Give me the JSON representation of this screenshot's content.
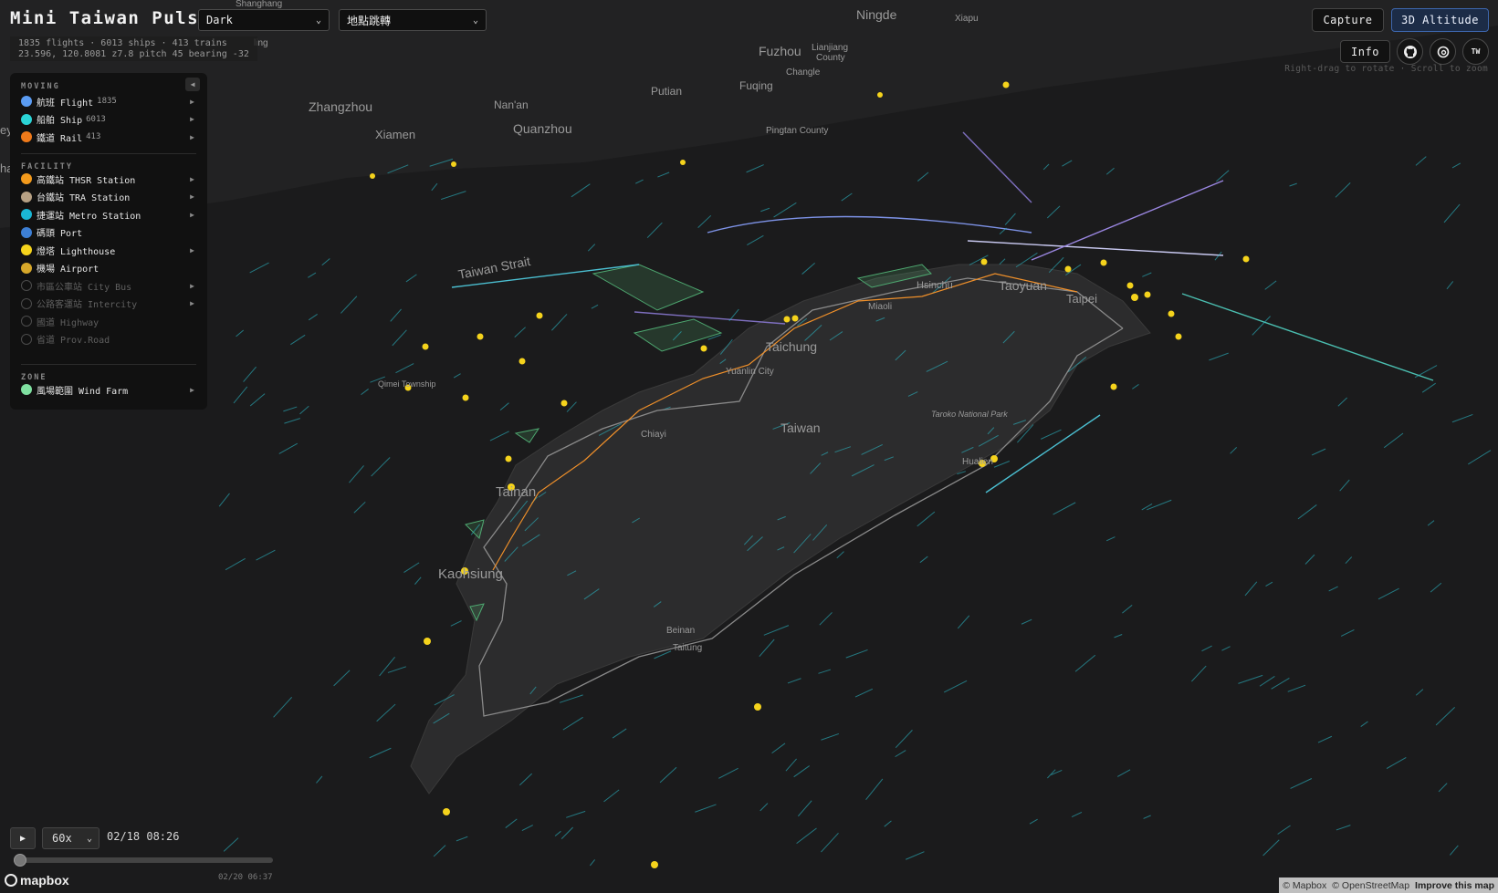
{
  "app": {
    "title": "Mini Taiwan Pulse",
    "theme_select": "Dark",
    "location_select": "地點跳轉"
  },
  "stats": {
    "line1": "1835 flights · 6013 ships · 413 trains",
    "line2": "23.596, 120.8081 z7.8 pitch 45 bearing -32"
  },
  "legend": {
    "collapse_icon": "◀",
    "moving_title": "MOVING",
    "moving": [
      {
        "label": "航班 Flight",
        "count": "1835",
        "color": "#5b9cf2"
      },
      {
        "label": "船舶 Ship",
        "count": "6013",
        "color": "#2bd4d6"
      },
      {
        "label": "鐵道 Rail",
        "count": "413",
        "color": "#f07a1a"
      }
    ],
    "facility_title": "FACILITY",
    "facilities": [
      {
        "label": "高鐵站 THSR Station",
        "color": "#f39a1c",
        "enabled": true,
        "arrow": true
      },
      {
        "label": "台鐵站 TRA Station",
        "color": "#b7a184",
        "enabled": true,
        "arrow": true
      },
      {
        "label": "捷運站 Metro Station",
        "color": "#1ab6d4",
        "enabled": true,
        "arrow": true
      },
      {
        "label": "碼頭 Port",
        "color": "#3d7fd4",
        "enabled": true,
        "arrow": false
      },
      {
        "label": "燈塔 Lighthouse",
        "color": "#f5d31c",
        "enabled": true,
        "arrow": true
      },
      {
        "label": "機場 Airport",
        "color": "#d7a82a",
        "enabled": true,
        "arrow": false
      },
      {
        "label": "市區公車站 City Bus",
        "color": "",
        "enabled": false,
        "arrow": true
      },
      {
        "label": "公路客運站 Intercity",
        "color": "",
        "enabled": false,
        "arrow": true
      },
      {
        "label": "國道 Highway",
        "color": "",
        "enabled": false,
        "arrow": false
      },
      {
        "label": "省道 Prov.Road",
        "color": "",
        "enabled": false,
        "arrow": false
      }
    ],
    "zone_title": "ZONE",
    "zones": [
      {
        "label": "風場範圍 Wind Farm",
        "color": "#7fe0a0",
        "arrow": true
      }
    ]
  },
  "toolbar": {
    "capture": "Capture",
    "altitude": "3D Altitude",
    "info": "Info",
    "github_icon": "github-icon",
    "threads_icon": "threads-icon",
    "lang": "TW",
    "hint": "Right-drag to rotate · Scroll to zoom"
  },
  "playback": {
    "play_icon": "▶",
    "speed": "60x",
    "current_time": "02/18 08:26",
    "end_time": "02/20 06:37",
    "progress": 0.01
  },
  "map": {
    "labels": {
      "shanghang": "Shanghang",
      "ningde": "Ningde",
      "xiapu": "Xiapu",
      "fuzhou": "Fuzhou",
      "lianjiang": "Lianjiang",
      "county": "County",
      "changle": "Changle",
      "putian": "Putian",
      "fuqing": "Fuqing",
      "zhangzhou": "Zhangzhou",
      "nanan": "Nan'an",
      "quanzhou": "Quanzhou",
      "xiamen": "Xiamen",
      "pingtan": "Pingtan County",
      "strait": "Taiwan Strait",
      "hsinchu": "Hsinchu",
      "taoyuan": "Taoyuan",
      "taipei": "Taipei",
      "miaoli": "Miaoli",
      "taichung": "Taichung",
      "yuanlin": "Yuanlin City",
      "qimei": "Qimei Township",
      "taiwan": "Taiwan",
      "taroko": "Taroko National Park",
      "chiayi": "Chiayi",
      "hualien": "Hualien",
      "tainan": "Tainan",
      "kaohsiung": "Kaohsiung",
      "beinan": "Beinan",
      "taitung": "Taitung",
      "ling": "ling",
      "edge1": "ey",
      "edge2": "ha"
    },
    "logo": "mapbox",
    "attribution": [
      "© Mapbox",
      "© OpenStreetMap",
      "Improve this map"
    ]
  }
}
